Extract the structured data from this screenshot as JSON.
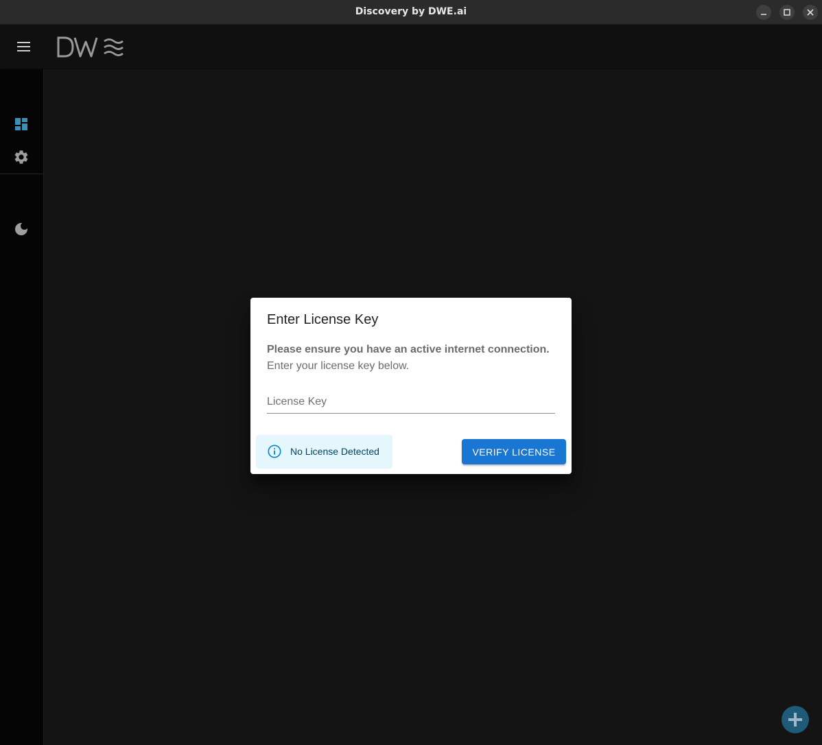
{
  "window": {
    "title": "Discovery by DWE.ai",
    "controls": [
      "minimize-icon",
      "maximize-icon",
      "close-icon"
    ]
  },
  "appbar": {
    "menu_icon": "hamburger-menu-icon",
    "logo_text": "DWE"
  },
  "sidebar": {
    "items": [
      {
        "name": "dashboard",
        "icon": "dashboard-icon",
        "active": true
      },
      {
        "name": "settings",
        "icon": "gear-icon",
        "active": false
      }
    ],
    "theme_toggle_icon": "moon-icon"
  },
  "dialog": {
    "title": "Enter License Key",
    "message_bold": "Please ensure you have an active internet connection.",
    "message": "Enter your license key below.",
    "license_field": {
      "value": "",
      "placeholder": "License Key"
    },
    "alert": {
      "icon": "info-icon",
      "text": "No License Detected"
    },
    "verify_button": "VERIFY LICENSE"
  },
  "fab": {
    "icon": "plus-icon"
  },
  "colors": {
    "accent": "#1976d2",
    "sidebar_active_icon": "#3d8fb5",
    "alert_bg": "#e5f6fd",
    "alert_text": "#014361",
    "fab_bg": "#1f5a78"
  }
}
